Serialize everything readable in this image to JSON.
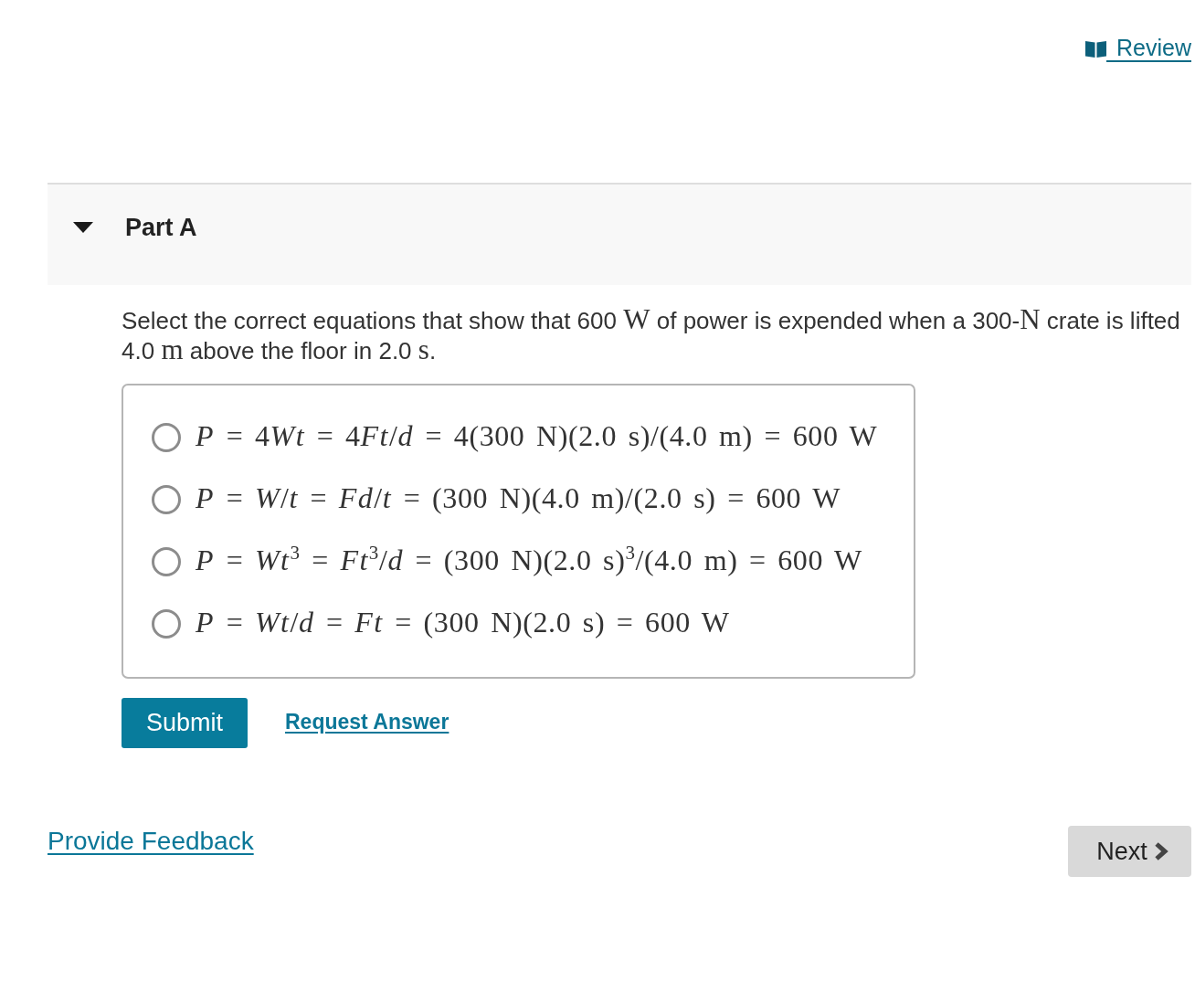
{
  "header": {
    "review_link": "Review"
  },
  "part": {
    "title": "Part A",
    "expanded": true,
    "question": [
      {
        "kind": "text",
        "text": "Select the correct equations that show that 600 "
      },
      {
        "kind": "math",
        "text": "W"
      },
      {
        "kind": "text",
        "text": " of power is expended when a 300-"
      },
      {
        "kind": "math",
        "text": "N"
      },
      {
        "kind": "text",
        "text": " crate is lifted 4.0 "
      },
      {
        "kind": "math",
        "text": "m"
      },
      {
        "kind": "text",
        "text": " above the floor in 2.0 "
      },
      {
        "kind": "math",
        "text": "s"
      },
      {
        "kind": "text",
        "text": "."
      }
    ],
    "options": [
      {
        "selected": false,
        "equation": [
          {
            "kind": "var",
            "text": "P"
          },
          {
            "kind": "text",
            "text": " = 4"
          },
          {
            "kind": "var",
            "text": "Wt"
          },
          {
            "kind": "text",
            "text": " = 4"
          },
          {
            "kind": "var",
            "text": "Ft"
          },
          {
            "kind": "text",
            "text": "/"
          },
          {
            "kind": "var",
            "text": "d"
          },
          {
            "kind": "text",
            "text": " = 4(300 N)(2.0 s)/(4.0 m) = 600 W"
          }
        ]
      },
      {
        "selected": false,
        "equation": [
          {
            "kind": "var",
            "text": "P"
          },
          {
            "kind": "text",
            "text": " = "
          },
          {
            "kind": "var",
            "text": "W"
          },
          {
            "kind": "text",
            "text": "/"
          },
          {
            "kind": "var",
            "text": "t"
          },
          {
            "kind": "text",
            "text": " = "
          },
          {
            "kind": "var",
            "text": "Fd"
          },
          {
            "kind": "text",
            "text": "/"
          },
          {
            "kind": "var",
            "text": "t"
          },
          {
            "kind": "text",
            "text": " = (300 N)(4.0 m)/(2.0 s) = 600 W"
          }
        ]
      },
      {
        "selected": false,
        "equation": [
          {
            "kind": "var",
            "text": "P"
          },
          {
            "kind": "text",
            "text": " = "
          },
          {
            "kind": "var",
            "text": "Wt"
          },
          {
            "kind": "sup",
            "text": "3"
          },
          {
            "kind": "text",
            "text": " = "
          },
          {
            "kind": "var",
            "text": "Ft"
          },
          {
            "kind": "sup",
            "text": "3"
          },
          {
            "kind": "text",
            "text": "/"
          },
          {
            "kind": "var",
            "text": "d"
          },
          {
            "kind": "text",
            "text": " = (300 N)(2.0 s)"
          },
          {
            "kind": "sup",
            "text": "3"
          },
          {
            "kind": "text",
            "text": "/(4.0 m) = 600 W"
          }
        ]
      },
      {
        "selected": false,
        "equation": [
          {
            "kind": "var",
            "text": "P"
          },
          {
            "kind": "text",
            "text": " = "
          },
          {
            "kind": "var",
            "text": "Wt"
          },
          {
            "kind": "text",
            "text": "/"
          },
          {
            "kind": "var",
            "text": "d"
          },
          {
            "kind": "text",
            "text": " = "
          },
          {
            "kind": "var",
            "text": "Ft"
          },
          {
            "kind": "text",
            "text": " = (300 N)(2.0 s) = 600 W"
          }
        ]
      }
    ],
    "submit_button": "Submit",
    "request_answer_link": "Request Answer"
  },
  "footer": {
    "feedback_link": "Provide Feedback",
    "next_button": "Next"
  }
}
